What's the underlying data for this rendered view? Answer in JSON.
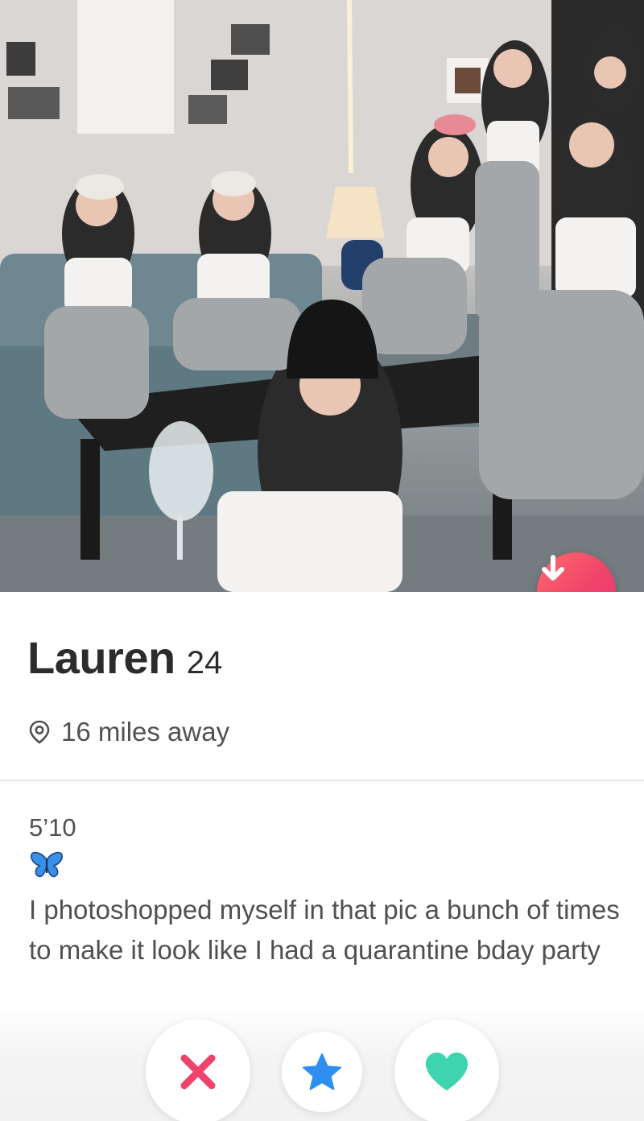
{
  "profile": {
    "name": "Lauren",
    "age": "24",
    "distance": "16 miles away",
    "height": "5’10",
    "bio": "I photoshopped myself in that pic a bunch of times to make it look like I had a quarantine bday party"
  },
  "icons": {
    "info_button": "arrow-down-icon",
    "distance": "location-pin-icon",
    "bio_emoji": "butterfly-icon",
    "nope": "x-icon",
    "superlike": "star-icon",
    "like": "heart-icon"
  },
  "colors": {
    "info_button": "#f0436b",
    "nope": "#f0436b",
    "superlike": "#2f8ff0",
    "like": "#3fd4b0",
    "butterfly": "#3a8fe6"
  }
}
